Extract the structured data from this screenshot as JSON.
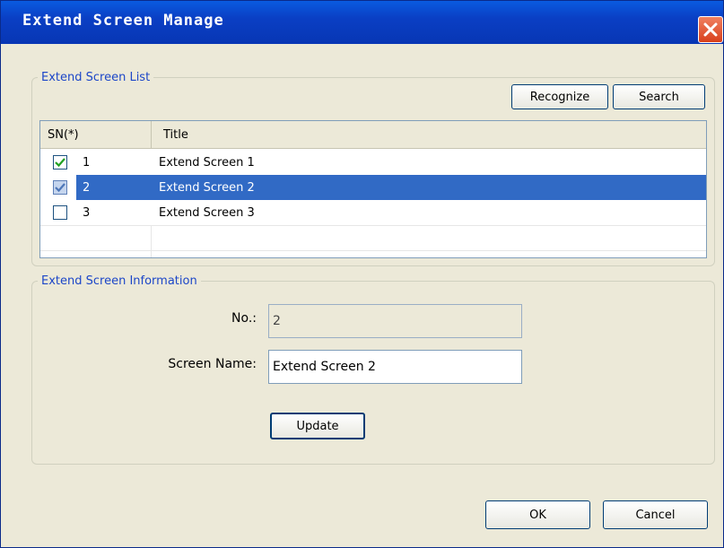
{
  "window": {
    "title": "Extend Screen Manage"
  },
  "list_group": {
    "legend": "Extend Screen List",
    "recognize_label": "Recognize",
    "search_label": "Search",
    "columns": [
      "SN(*)",
      "Title"
    ],
    "rows": [
      {
        "sn": "1",
        "title": "Extend Screen 1",
        "checked": true,
        "selected": false
      },
      {
        "sn": "2",
        "title": "Extend Screen 2",
        "checked": true,
        "selected": true
      },
      {
        "sn": "3",
        "title": "Extend Screen 3",
        "checked": false,
        "selected": false
      }
    ]
  },
  "info_group": {
    "legend": "Extend Screen Information",
    "no_label": "No.:",
    "no_value": "2",
    "name_label": "Screen Name:",
    "name_value": "Extend Screen 2",
    "update_label": "Update"
  },
  "footer": {
    "ok_label": "OK",
    "cancel_label": "Cancel"
  },
  "colors": {
    "selection": "#316ac5",
    "title_bar": "#0a3fc4",
    "close_button": "#d8401c",
    "legend_text": "#1c46c8",
    "dialog_bg": "#ece9d8"
  }
}
